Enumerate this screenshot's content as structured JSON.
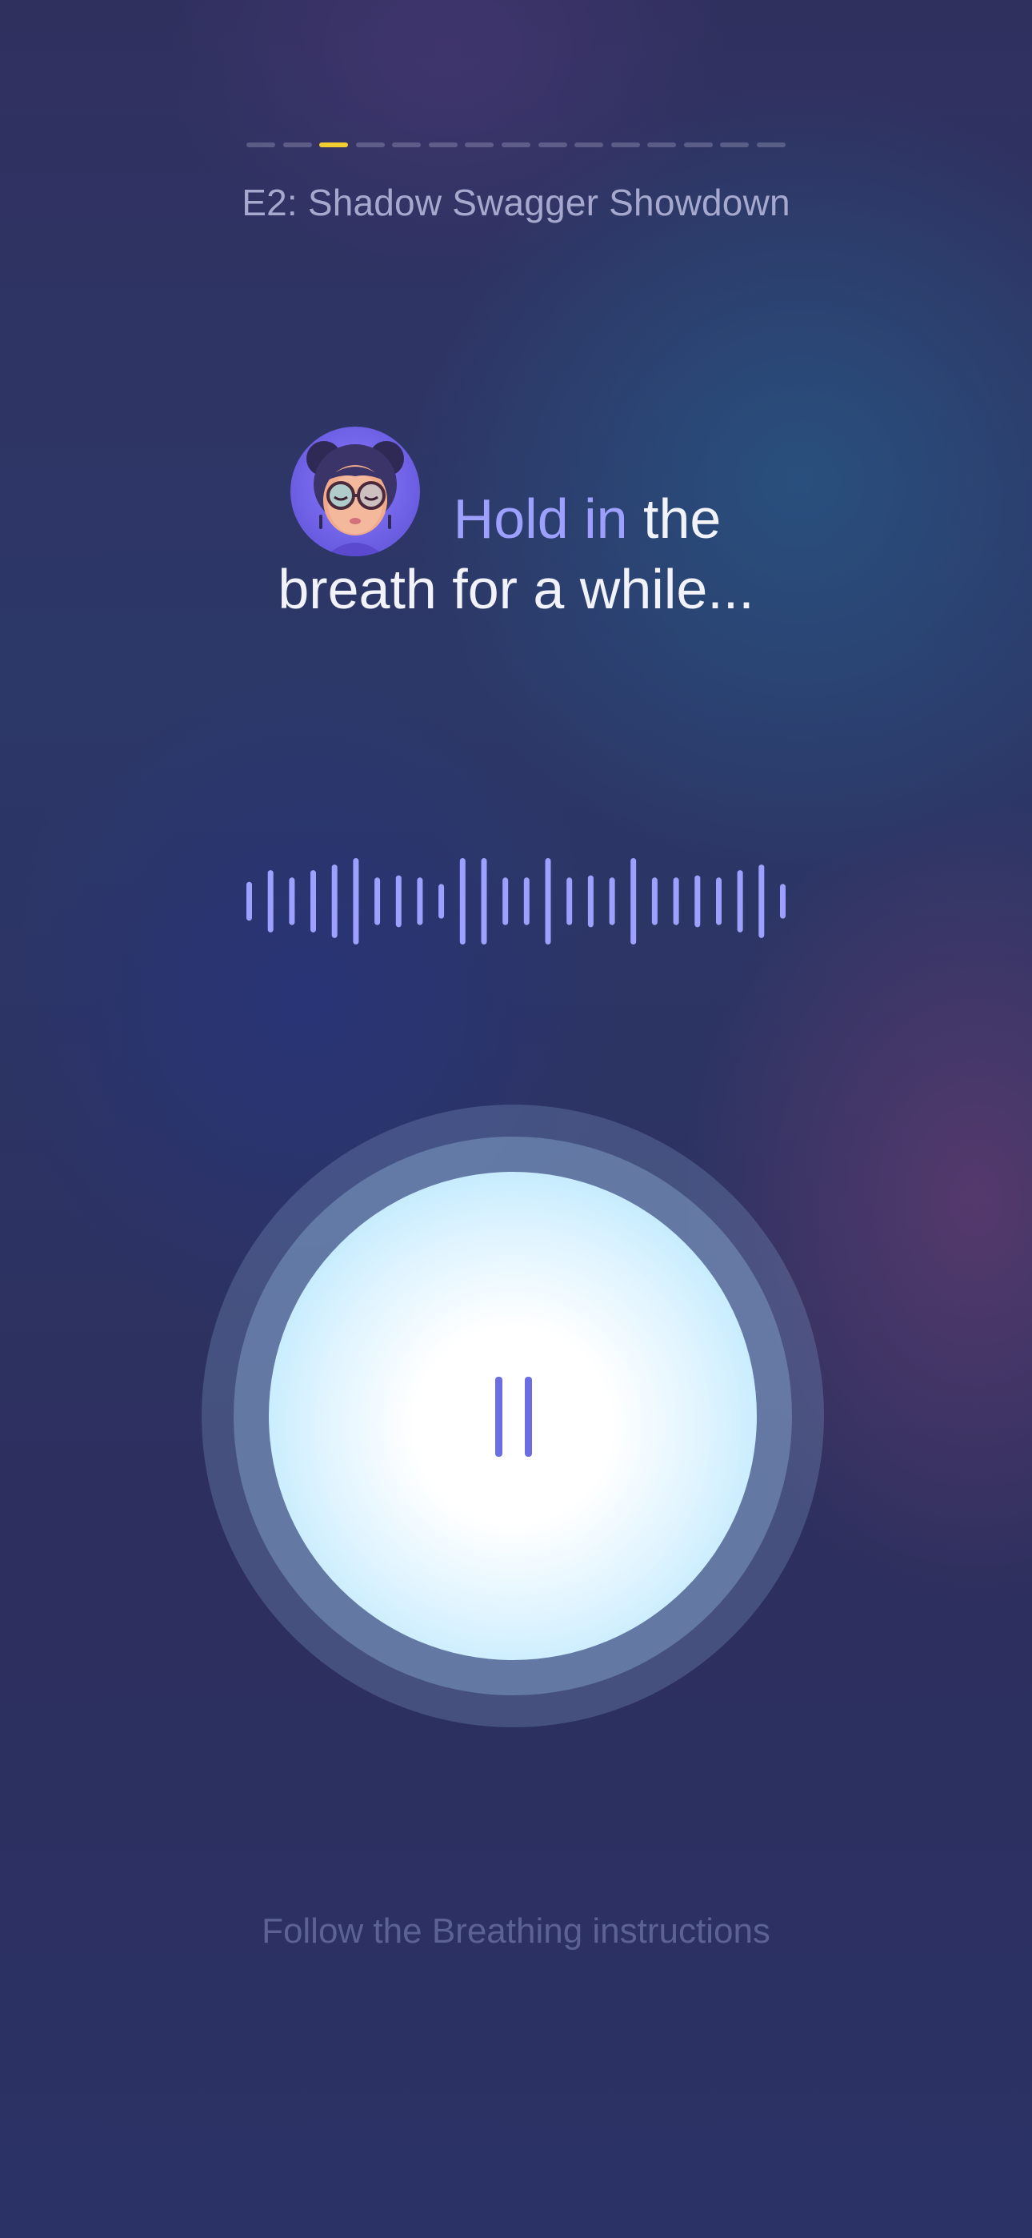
{
  "progress": {
    "total_segments": 15,
    "current_segment": 3,
    "active_color": "#f2cc2e"
  },
  "episode": {
    "title": "E2: Shadow Swagger Showdown"
  },
  "instruction": {
    "highlight": "Hold in",
    "line1_rest": " the",
    "line2": "breath for a while...",
    "highlight_color": "#9da0ff"
  },
  "avatar": {
    "icon": "character-avatar-icon"
  },
  "waveform": {
    "icon": "audio-waveform-icon",
    "color": "#9da0ff",
    "bar_levels": [
      0.45,
      0.72,
      0.55,
      0.72,
      0.85,
      1.0,
      0.55,
      0.6,
      0.55,
      0.4,
      1.0,
      1.0,
      0.55,
      0.55,
      1.0,
      0.55,
      0.6,
      0.55,
      1.0,
      0.55,
      0.55,
      0.6,
      0.55,
      0.72,
      0.85,
      0.4
    ]
  },
  "breath_button": {
    "icon": "pause-icon",
    "icon_color": "#6a6ee0"
  },
  "footer": {
    "hint": "Follow the Breathing instructions"
  }
}
